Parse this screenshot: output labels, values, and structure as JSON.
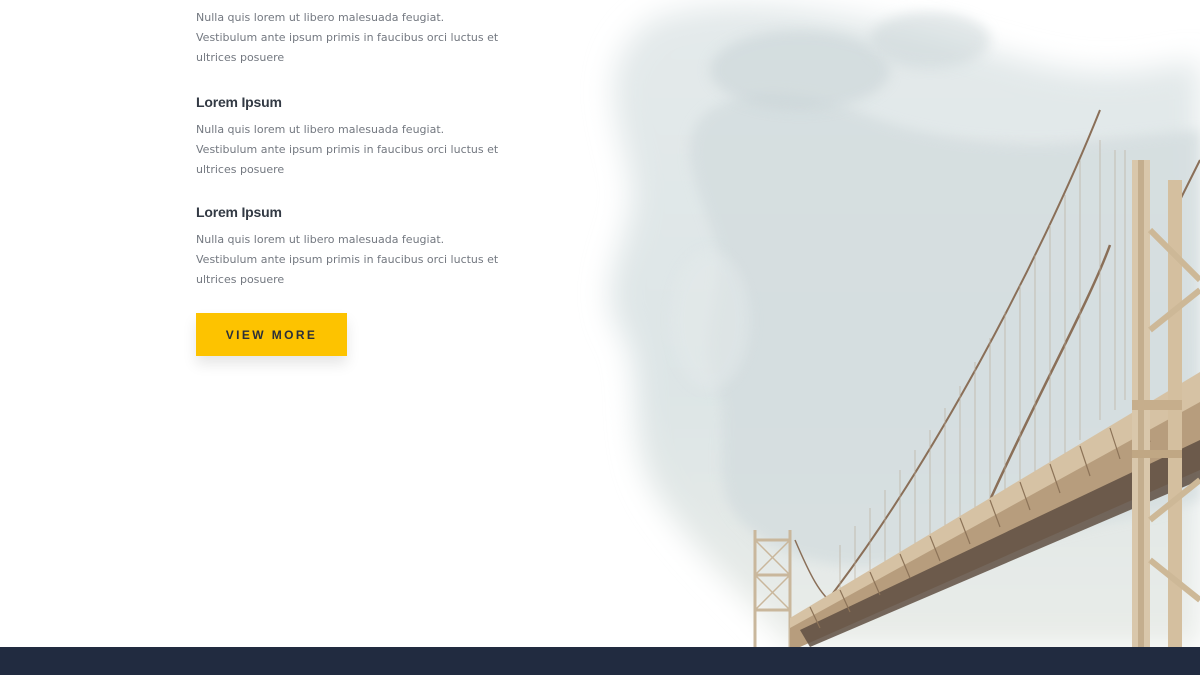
{
  "features": [
    {
      "title": "",
      "text": "Nulla quis lorem ut libero malesuada feugiat. Vestibulum ante ipsum primis in faucibus orci luctus et ultrices posuere"
    },
    {
      "title": "Lorem Ipsum",
      "text": "Nulla quis lorem ut libero malesuada feugiat. Vestibulum ante ipsum primis in faucibus orci luctus et ultrices posuere"
    },
    {
      "title": "Lorem Ipsum",
      "text": "Nulla quis lorem ut libero malesuada feugiat. Vestibulum ante ipsum primis in faucibus orci luctus et ultrices posuere"
    }
  ],
  "cta": {
    "label": "VIEW MORE",
    "background_color": "#fdc300"
  },
  "colors": {
    "footer_band": "#212b40",
    "heading": "#333a44",
    "body_text": "#737880"
  },
  "hero_image": {
    "subject": "suspension-bridge-watercolor"
  }
}
